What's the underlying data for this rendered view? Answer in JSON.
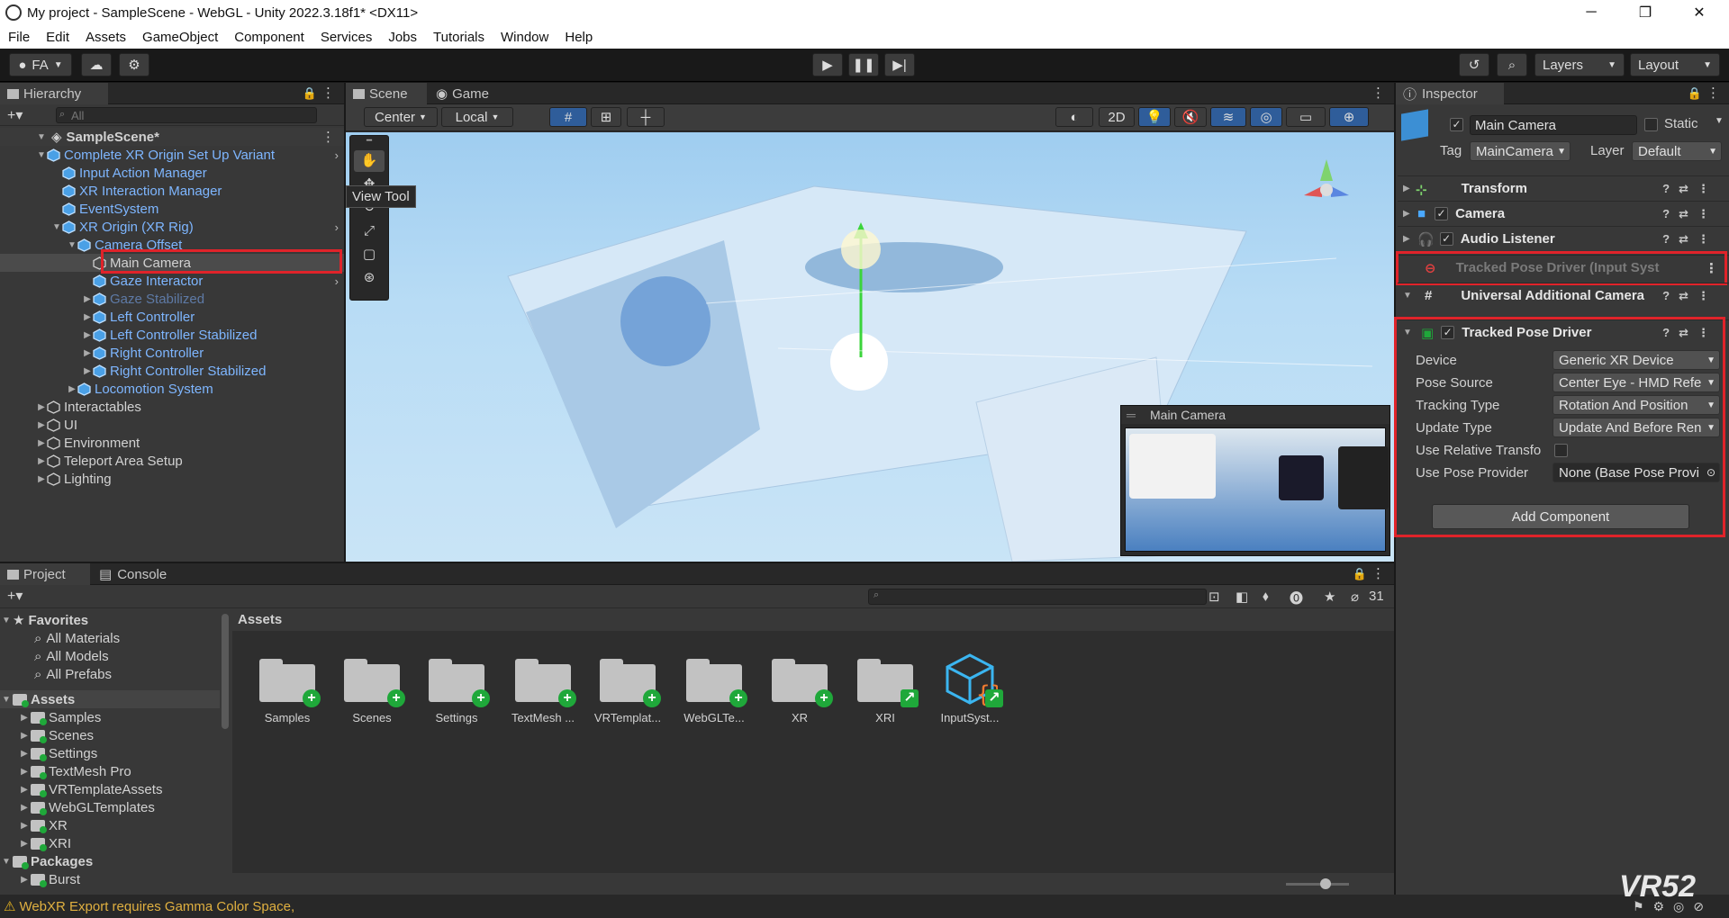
{
  "window": {
    "title": "My project - SampleScene - WebGL - Unity 2022.3.18f1* <DX11>",
    "minimize": "─",
    "maximize": "❐",
    "close": "✕"
  },
  "menu": [
    "File",
    "Edit",
    "Assets",
    "GameObject",
    "Component",
    "Services",
    "Jobs",
    "Tutorials",
    "Window",
    "Help"
  ],
  "toolbar": {
    "account": "FA",
    "layers": "Layers",
    "layout": "Layout"
  },
  "hierarchy": {
    "tab": "Hierarchy",
    "search_placeholder": "All",
    "scene": "SampleScene*",
    "items": [
      {
        "label": "Complete XR Origin Set Up Variant",
        "depth": 1,
        "expanded": true,
        "style": "blue",
        "arrow": true
      },
      {
        "label": "Input Action Manager",
        "depth": 2,
        "style": "blue"
      },
      {
        "label": "XR Interaction Manager",
        "depth": 2,
        "style": "blue"
      },
      {
        "label": "EventSystem",
        "depth": 2,
        "style": "blue"
      },
      {
        "label": "XR Origin (XR Rig)",
        "depth": 2,
        "expanded": true,
        "style": "blue",
        "arrow": true
      },
      {
        "label": "Camera Offset",
        "depth": 3,
        "expanded": true,
        "style": "blue"
      },
      {
        "label": "Main Camera",
        "depth": 4,
        "style": "normal",
        "selected": true
      },
      {
        "label": "Gaze Interactor",
        "depth": 4,
        "style": "blue",
        "arrow": true
      },
      {
        "label": "Gaze Stabilized",
        "depth": 4,
        "collapsed": true,
        "style": "dim"
      },
      {
        "label": "Left Controller",
        "depth": 4,
        "collapsed": true,
        "style": "blue"
      },
      {
        "label": "Left Controller Stabilized",
        "depth": 4,
        "collapsed": true,
        "style": "blue"
      },
      {
        "label": "Right Controller",
        "depth": 4,
        "collapsed": true,
        "style": "blue"
      },
      {
        "label": "Right Controller Stabilized",
        "depth": 4,
        "collapsed": true,
        "style": "blue"
      },
      {
        "label": "Locomotion System",
        "depth": 3,
        "collapsed": true,
        "style": "blue"
      },
      {
        "label": "Interactables",
        "depth": 1,
        "collapsed": true,
        "style": "normal"
      },
      {
        "label": "UI",
        "depth": 1,
        "collapsed": true,
        "style": "normal"
      },
      {
        "label": "Environment",
        "depth": 1,
        "collapsed": true,
        "style": "normal"
      },
      {
        "label": "Teleport Area Setup",
        "depth": 1,
        "collapsed": true,
        "style": "normal"
      },
      {
        "label": "Lighting",
        "depth": 1,
        "collapsed": true,
        "style": "normal"
      }
    ]
  },
  "scene_view": {
    "tab_scene": "Scene",
    "tab_game": "Game",
    "pivot": "Center",
    "space": "Local",
    "mode_2d": "2D",
    "tooltip": "View Tool",
    "preview_title": "Main Camera"
  },
  "inspector": {
    "tab": "Inspector",
    "object_name": "Main Camera",
    "static_label": "Static",
    "tag_label": "Tag",
    "tag_value": "MainCamera",
    "layer_label": "Layer",
    "layer_value": "Default",
    "components": [
      "Transform",
      "Camera",
      "Audio Listener",
      "Tracked Pose Driver (Input Syst",
      "Universal Additional Camera",
      "Tracked Pose Driver"
    ],
    "props": [
      {
        "label": "Device",
        "value": "Generic XR Device"
      },
      {
        "label": "Pose Source",
        "value": "Center Eye - HMD Refe"
      },
      {
        "label": "Tracking Type",
        "value": "Rotation And Position"
      },
      {
        "label": "Update Type",
        "value": "Update And Before Ren"
      },
      {
        "label": "Use Relative Transfo",
        "value": ""
      },
      {
        "label": "Use Pose Provider",
        "value": "None (Base Pose Provi"
      }
    ],
    "add_component": "Add Component"
  },
  "project": {
    "tab_project": "Project",
    "tab_console": "Console",
    "hidden_count": "31",
    "favorites": "Favorites",
    "fav_items": [
      "All Materials",
      "All Models",
      "All Prefabs"
    ],
    "assets_header": "Assets",
    "tree": [
      "Samples",
      "Scenes",
      "Settings",
      "TextMesh Pro",
      "VRTemplateAssets",
      "WebGLTemplates",
      "XR",
      "XRI"
    ],
    "packages": "Packages",
    "packages_first": "Burst",
    "grid_title": "Assets",
    "grid": [
      "Samples",
      "Scenes",
      "Settings",
      "TextMesh ...",
      "VRTemplat...",
      "WebGLTe...",
      "XR",
      "XRI",
      "InputSyst..."
    ]
  },
  "status": {
    "message": "WebXR Export requires Gamma Color Space,"
  },
  "watermark": "VR52"
}
